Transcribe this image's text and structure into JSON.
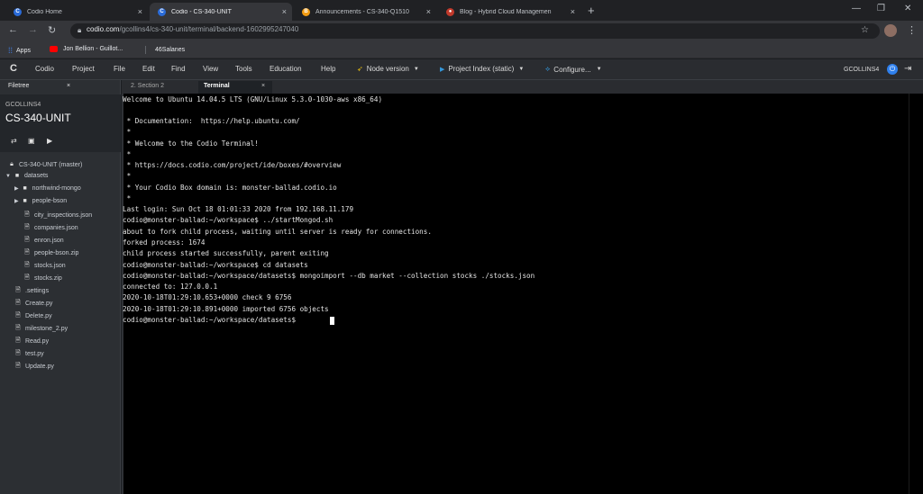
{
  "browser": {
    "tabs": [
      {
        "title": "Codio Home",
        "active": false
      },
      {
        "title": "Codio - CS-340-UNIT",
        "active": true
      },
      {
        "title": "Announcements - CS-340-Q1510",
        "active": false
      },
      {
        "title": "Blog - Hybrid Cloud Managemen",
        "active": false
      }
    ],
    "tab_close": "×",
    "new_tab": "+",
    "url_host": "codio.com",
    "url_path": "/gcollins4/cs-340-unit/terminal/backend-1602995247040",
    "bookmarks": [
      {
        "label": "Apps"
      },
      {
        "label": "Jon Bellion - Guillot..."
      },
      {
        "label": "46Salanes"
      }
    ]
  },
  "codio": {
    "menu": [
      "Codio",
      "Project",
      "File",
      "Edit",
      "Find",
      "View",
      "Tools",
      "Education",
      "Help"
    ],
    "node_version": "Node version",
    "project_index": "Project Index (static)",
    "configure": "Configure...",
    "username": "GCOLLINS4"
  },
  "filetree": {
    "tab_label": "Filetree",
    "owner": "GCOLLINS4",
    "project": "CS-340-UNIT",
    "root": "CS-340-UNIT (master)",
    "items": [
      {
        "label": "datasets",
        "type": "folder-open"
      },
      {
        "label": "northwind-mongo",
        "type": "folder"
      },
      {
        "label": "people-bson",
        "type": "folder"
      },
      {
        "label": "city_inspections.json",
        "type": "file"
      },
      {
        "label": "companies.json",
        "type": "file"
      },
      {
        "label": "enron.json",
        "type": "file"
      },
      {
        "label": "people-bson.zip",
        "type": "file"
      },
      {
        "label": "stocks.json",
        "type": "file"
      },
      {
        "label": "stocks.zip",
        "type": "file"
      },
      {
        "label": ".settings",
        "type": "file"
      },
      {
        "label": "Create.py",
        "type": "file"
      },
      {
        "label": "Delete.py",
        "type": "file"
      },
      {
        "label": "milestone_2.py",
        "type": "file"
      },
      {
        "label": "Read.py",
        "type": "file"
      },
      {
        "label": "test.py",
        "type": "file"
      },
      {
        "label": "Update.py",
        "type": "file"
      }
    ]
  },
  "terminal": {
    "tabs": [
      "2. Section 2",
      "Terminal"
    ],
    "lines": [
      "Welcome to Ubuntu 14.04.5 LTS (GNU/Linux 5.3.0-1030-aws x86_64)",
      "",
      " * Documentation:  https://help.ubuntu.com/",
      " *",
      " * Welcome to the Codio Terminal!",
      " *",
      " * https://docs.codio.com/project/ide/boxes/#overview",
      " *",
      " * Your Codio Box domain is: monster-ballad.codio.io",
      " *",
      "Last login: Sun Oct 18 01:01:33 2020 from 192.168.11.179",
      "codio@monster-ballad:~/workspace$ ../startMongod.sh",
      "about to fork child process, waiting until server is ready for connections.",
      "forked process: 1674",
      "child process started successfully, parent exiting",
      "codio@monster-ballad:~/workspace$ cd datasets",
      "codio@monster-ballad:~/workspace/datasets$ mongoimport --db market --collection stocks ./stocks.json",
      "connected to: 127.0.0.1",
      "2020-10-18T01:29:10.653+0000 check 9 6756",
      "2020-10-18T01:29:10.891+0000 imported 6756 objects",
      "codio@monster-ballad:~/workspace/datasets$ "
    ]
  }
}
